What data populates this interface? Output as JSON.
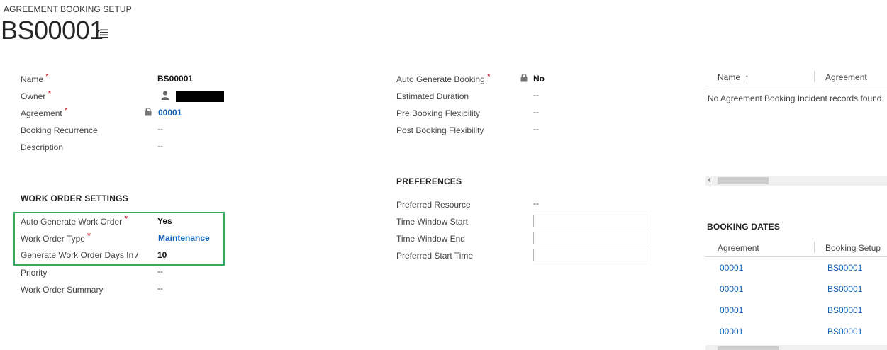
{
  "header": {
    "entity_label": "AGREEMENT BOOKING SETUP",
    "record_name": "BS00001"
  },
  "general": {
    "fields": [
      {
        "label": "Name",
        "required": "*",
        "value": "BS00001"
      },
      {
        "label": "Owner",
        "required": "*",
        "value": ""
      },
      {
        "label": "Agreement",
        "required": "*",
        "value": "00001"
      },
      {
        "label": "Booking Recurrence",
        "value": "--"
      },
      {
        "label": "Description",
        "value": "--"
      }
    ]
  },
  "work_order_settings": {
    "title": "WORK ORDER SETTINGS",
    "fields": [
      {
        "label": "Auto Generate Work Order",
        "required": "*",
        "value": "Yes"
      },
      {
        "label": "Work Order Type",
        "required": "*",
        "value": "Maintenance"
      },
      {
        "label": "Generate Work Order Days In A",
        "value": "10"
      },
      {
        "label": "Priority",
        "value": "--"
      },
      {
        "label": "Work Order Summary",
        "value": "--"
      }
    ]
  },
  "booking": {
    "fields": [
      {
        "label": "Auto Generate Booking",
        "required": "*",
        "value": "No"
      },
      {
        "label": "Estimated Duration",
        "value": "--"
      },
      {
        "label": "Pre Booking Flexibility",
        "value": "--"
      },
      {
        "label": "Post Booking Flexibility",
        "value": "--"
      }
    ]
  },
  "preferences": {
    "title": "PREFERENCES",
    "fields": [
      {
        "label": "Preferred Resource",
        "value": "--"
      },
      {
        "label": "Time Window Start",
        "value": ""
      },
      {
        "label": "Time Window End",
        "value": ""
      },
      {
        "label": "Preferred Start Time",
        "value": ""
      }
    ]
  },
  "incidents_grid": {
    "columns": [
      "Name",
      "Agreement"
    ],
    "sort_indicator": "↑",
    "empty_message": "No Agreement Booking Incident records found."
  },
  "booking_dates": {
    "title": "BOOKING DATES",
    "columns": [
      "Agreement",
      "Booking Setup"
    ],
    "rows": [
      [
        "00001",
        "BS00001"
      ],
      [
        "00001",
        "BS00001"
      ],
      [
        "00001",
        "BS00001"
      ],
      [
        "00001",
        "BS00001"
      ]
    ]
  },
  "icons": {
    "menu": "list-menu-icon",
    "lock": "lock-icon",
    "user": "person-icon"
  },
  "colors": {
    "link": "#1160b7",
    "required": "#d0021b",
    "highlight": "#3aa85a"
  }
}
